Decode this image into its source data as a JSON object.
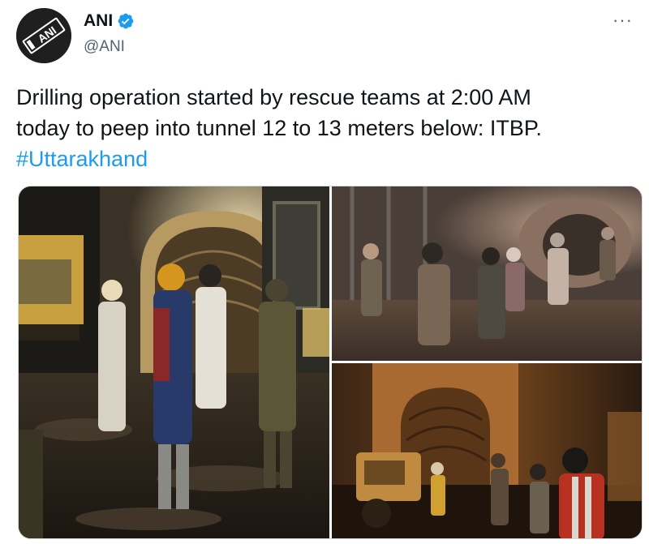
{
  "tweet": {
    "author": {
      "display_name": "ANI",
      "handle": "@ANI",
      "avatar_text": "ANI",
      "avatar_icon": "ani-logo-icon",
      "verified_icon": "verified-badge-icon"
    },
    "more_icon": "more-options-icon",
    "more_label": "···",
    "text_lines": [
      "Drilling operation started by rescue teams at 2:00 AM",
      "today to peep into tunnel 12 to 13 meters below: ITBP."
    ],
    "hashtag": "#Uttarakhand",
    "photos": [
      {
        "subject": "rescue-team-at-tunnel-entrance-photo"
      },
      {
        "subject": "rescuers-walking-through-tunnel-photo"
      },
      {
        "subject": "tunnel-mouth-at-night-photo"
      }
    ],
    "colors": {
      "link": "#1d9bf0",
      "verified": "#1d9bf0",
      "secondary_text": "#536471"
    }
  }
}
